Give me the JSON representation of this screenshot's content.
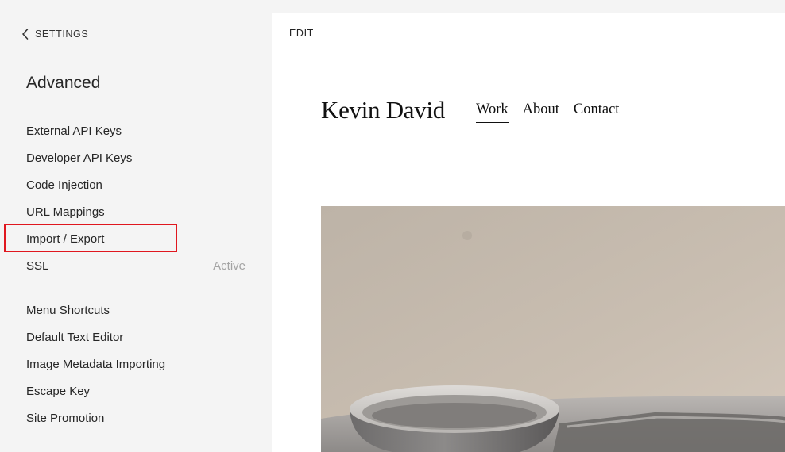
{
  "sidebar": {
    "back_label": "SETTINGS",
    "title": "Advanced",
    "items": [
      {
        "label": "External API Keys"
      },
      {
        "label": "Developer API Keys"
      },
      {
        "label": "Code Injection"
      },
      {
        "label": "URL Mappings"
      },
      {
        "label": "Import / Export",
        "highlighted": true
      },
      {
        "label": "SSL",
        "status": "Active"
      }
    ],
    "items2": [
      {
        "label": "Menu Shortcuts"
      },
      {
        "label": "Default Text Editor"
      },
      {
        "label": "Image Metadata Importing"
      },
      {
        "label": "Escape Key"
      },
      {
        "label": "Site Promotion"
      }
    ]
  },
  "preview": {
    "edit_label": "EDIT",
    "site_title": "Kevin David",
    "nav": [
      {
        "label": "Work",
        "active": true
      },
      {
        "label": "About"
      },
      {
        "label": "Contact"
      }
    ]
  },
  "colors": {
    "sidebar_bg": "#f4f4f4",
    "highlight": "#e0171f",
    "status_text": "#a3a3a3"
  },
  "icons": {
    "back": "chevron-left-icon"
  }
}
